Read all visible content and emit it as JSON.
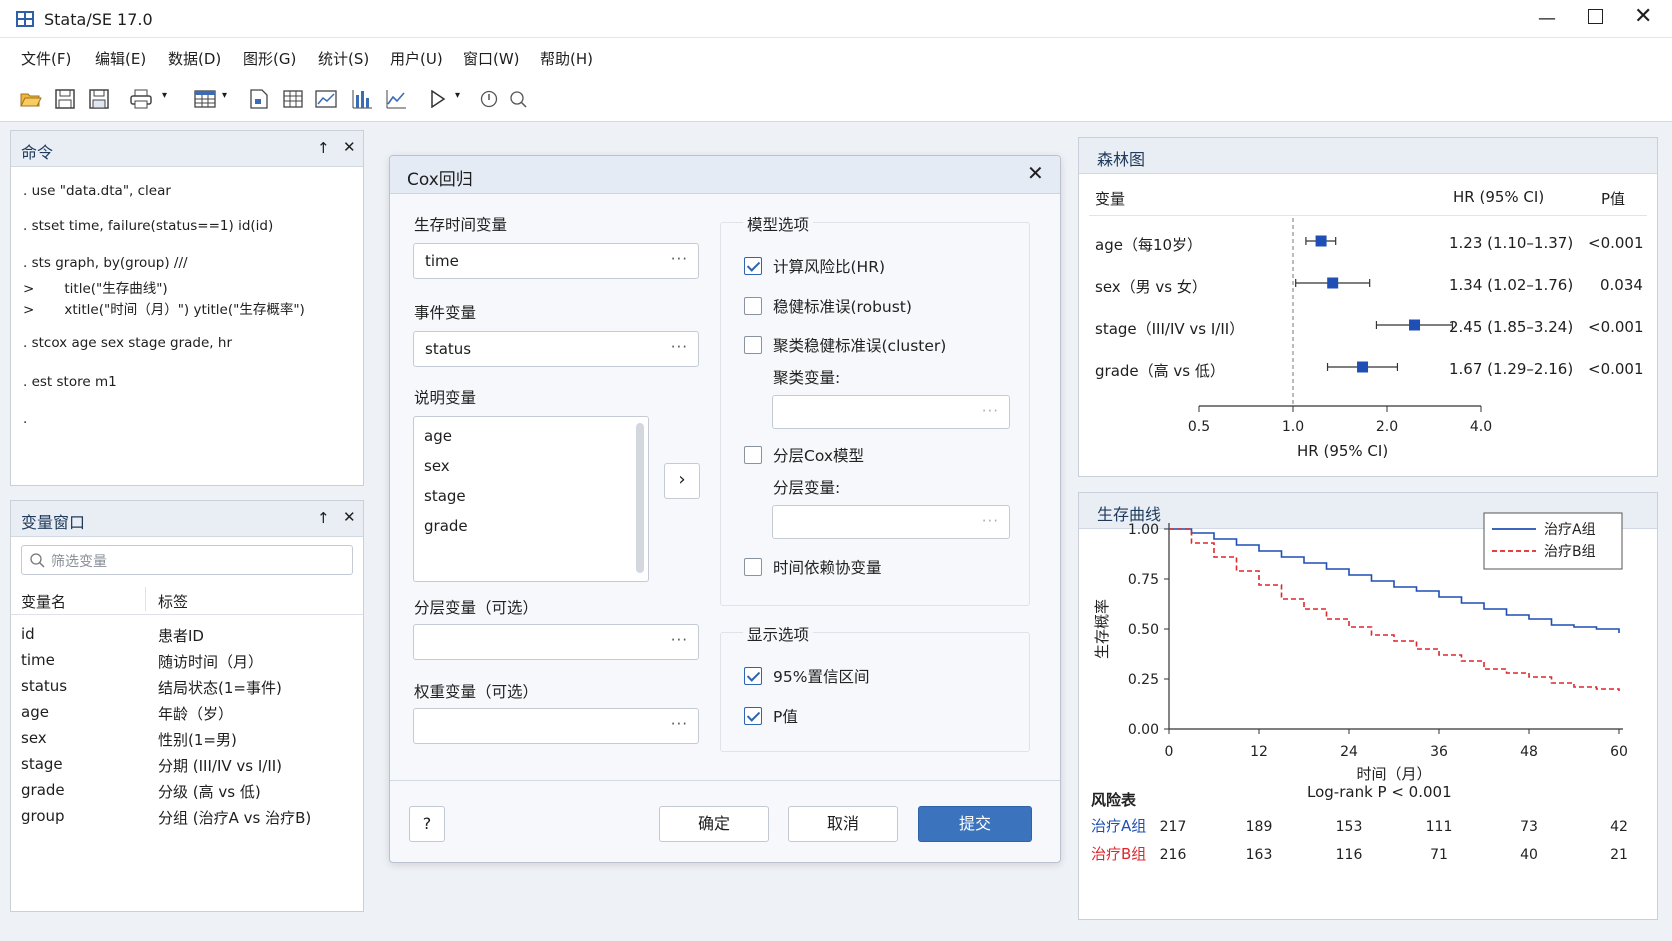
{
  "window": {
    "title": "Stata/SE 17.0"
  },
  "menu": [
    "文件(F)",
    "编辑(E)",
    "数据(D)",
    "图形(G)",
    "统计(S)",
    "用户(U)",
    "窗口(W)",
    "帮助(H)"
  ],
  "command_panel": {
    "title": "命令",
    "lines": [
      ". use \"data.dta\", clear",
      ". stset time, failure(status==1) id(id)",
      ". sts graph, by(group) ///",
      ">       title(\"生存曲线\")",
      ">       xtitle(\"时间（月）\") ytitle(\"生存概率\")",
      ". stcox age sex stage grade, hr",
      ". est store m1",
      "."
    ]
  },
  "var_panel": {
    "title": "变量窗口",
    "search_placeholder": "筛选变量",
    "col_name": "变量名",
    "col_label": "标签",
    "rows": [
      {
        "name": "id",
        "label": "患者ID"
      },
      {
        "name": "time",
        "label": "随访时间（月）"
      },
      {
        "name": "status",
        "label": "结局状态(1=事件)"
      },
      {
        "name": "age",
        "label": "年龄（岁）"
      },
      {
        "name": "sex",
        "label": "性别(1=男)"
      },
      {
        "name": "stage",
        "label": "分期 (III/IV vs I/II)"
      },
      {
        "name": "grade",
        "label": "分级 (高 vs 低)"
      },
      {
        "name": "group",
        "label": "分组 (治疗A vs 治疗B)"
      }
    ]
  },
  "dialog": {
    "title": "Cox回归",
    "time_var_label": "生存时间变量",
    "time_var_value": "time",
    "event_var_label": "事件变量",
    "event_var_value": "status",
    "explain_label": "说明变量",
    "explain_items": [
      "age",
      "sex",
      "stage",
      "grade"
    ],
    "strata_label": "分层变量（可选）",
    "weight_label": "权重变量（可选）",
    "model_group": "模型选项",
    "opt_hr": "计算风险比(HR)",
    "opt_robust": "稳健标准误(robust)",
    "opt_cluster": "聚类稳健标准误(cluster)",
    "cluster_var_label": "聚类变量:",
    "opt_strata_cox": "分层Cox模型",
    "strata_var_label": "分层变量:",
    "opt_tvc": "时间依赖协变量",
    "display_group": "显示选项",
    "opt_ci": "95%置信区间",
    "opt_p": "P值",
    "help": "?",
    "ok": "确定",
    "cancel": "取消",
    "submit": "提交",
    "states": {
      "hr": true,
      "robust": false,
      "cluster": false,
      "strata_cox": false,
      "tvc": false,
      "ci": true,
      "p": true
    }
  },
  "forest": {
    "title": "森林图",
    "col_var": "变量",
    "col_hr": "HR (95% CI)",
    "col_p": "P值",
    "rows": [
      {
        "label": "age（每10岁）",
        "hr": 1.23,
        "lo": 1.1,
        "hi": 1.37,
        "text": "1.23 (1.10–1.37)",
        "p": "<0.001"
      },
      {
        "label": "sex（男 vs 女）",
        "hr": 1.34,
        "lo": 1.02,
        "hi": 1.76,
        "text": "1.34 (1.02–1.76)",
        "p": "0.034"
      },
      {
        "label": "stage（III/IV vs I/II）",
        "hr": 2.45,
        "lo": 1.85,
        "hi": 3.24,
        "text": "2.45 (1.85–3.24)",
        "p": "<0.001"
      },
      {
        "label": "grade（高 vs 低）",
        "hr": 1.67,
        "lo": 1.29,
        "hi": 2.16,
        "text": "1.67 (1.29–2.16)",
        "p": "<0.001"
      }
    ],
    "ticks": [
      "0.5",
      "1.0",
      "2.0",
      "4.0"
    ],
    "xlabel": "HR (95% CI)"
  },
  "chart_data": {
    "type": "line",
    "title": "生存曲线",
    "xlabel": "时间（月）",
    "ylabel": "生存概率",
    "xlim": [
      0,
      60
    ],
    "ylim": [
      0,
      1
    ],
    "xticks": [
      "0",
      "12",
      "24",
      "36",
      "48",
      "60"
    ],
    "yticks": [
      "0.00",
      "0.25",
      "0.50",
      "0.75",
      "1.00"
    ],
    "legend": "top-right",
    "annotation": "Log-rank P < 0.001",
    "series": [
      {
        "name": "治疗A组",
        "color": "#1f4fb5",
        "x": [
          0,
          3,
          6,
          9,
          12,
          15,
          18,
          21,
          24,
          27,
          30,
          33,
          36,
          39,
          42,
          45,
          48,
          51,
          54,
          57,
          60
        ],
        "y": [
          1.0,
          0.98,
          0.95,
          0.92,
          0.89,
          0.86,
          0.83,
          0.8,
          0.77,
          0.74,
          0.71,
          0.69,
          0.66,
          0.63,
          0.6,
          0.57,
          0.55,
          0.52,
          0.51,
          0.5,
          0.48
        ]
      },
      {
        "name": "治疗B组",
        "color": "#e0262c",
        "x": [
          0,
          3,
          6,
          9,
          12,
          15,
          18,
          21,
          24,
          27,
          30,
          33,
          36,
          39,
          42,
          45,
          48,
          51,
          54,
          57,
          60
        ],
        "y": [
          1.0,
          0.93,
          0.86,
          0.79,
          0.72,
          0.65,
          0.6,
          0.55,
          0.51,
          0.47,
          0.44,
          0.4,
          0.37,
          0.34,
          0.3,
          0.28,
          0.26,
          0.23,
          0.21,
          0.2,
          0.19
        ]
      }
    ],
    "risk_table": {
      "title": "风险表",
      "rows": [
        {
          "name": "治疗A组",
          "values": [
            "217",
            "189",
            "153",
            "111",
            "73",
            "42"
          ]
        },
        {
          "name": "治疗B组",
          "values": [
            "216",
            "163",
            "116",
            "71",
            "40",
            "21"
          ]
        }
      ]
    }
  }
}
